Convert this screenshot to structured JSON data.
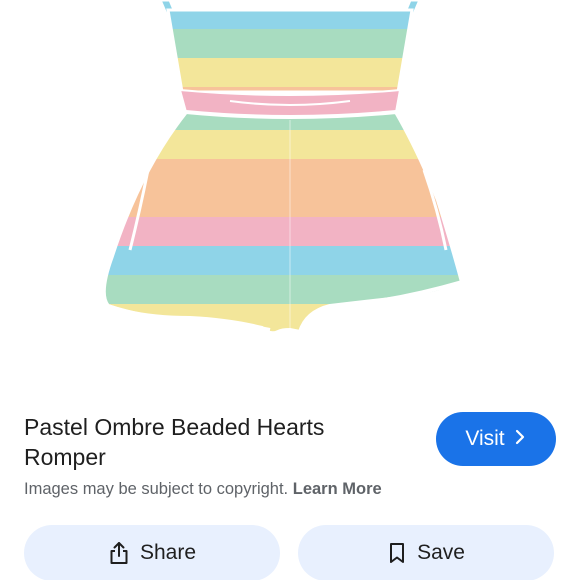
{
  "product": {
    "title": "Pastel Ombre Beaded Hearts Romper",
    "image_colors": [
      "#8fd4e8",
      "#a8dcc0",
      "#f3e69a",
      "#f7c39a",
      "#f2b3c4",
      "#c9b7e6"
    ]
  },
  "visit": {
    "label": "Visit",
    "color": "#1a73e8",
    "icon": "chevron-right-icon"
  },
  "copyright": {
    "text": "Images may be subject to copyright.",
    "link": "Learn More"
  },
  "actions": {
    "share_label": "Share",
    "share_icon": "share-icon",
    "save_label": "Save",
    "save_icon": "bookmark-icon",
    "background": "#e8f0fe"
  }
}
